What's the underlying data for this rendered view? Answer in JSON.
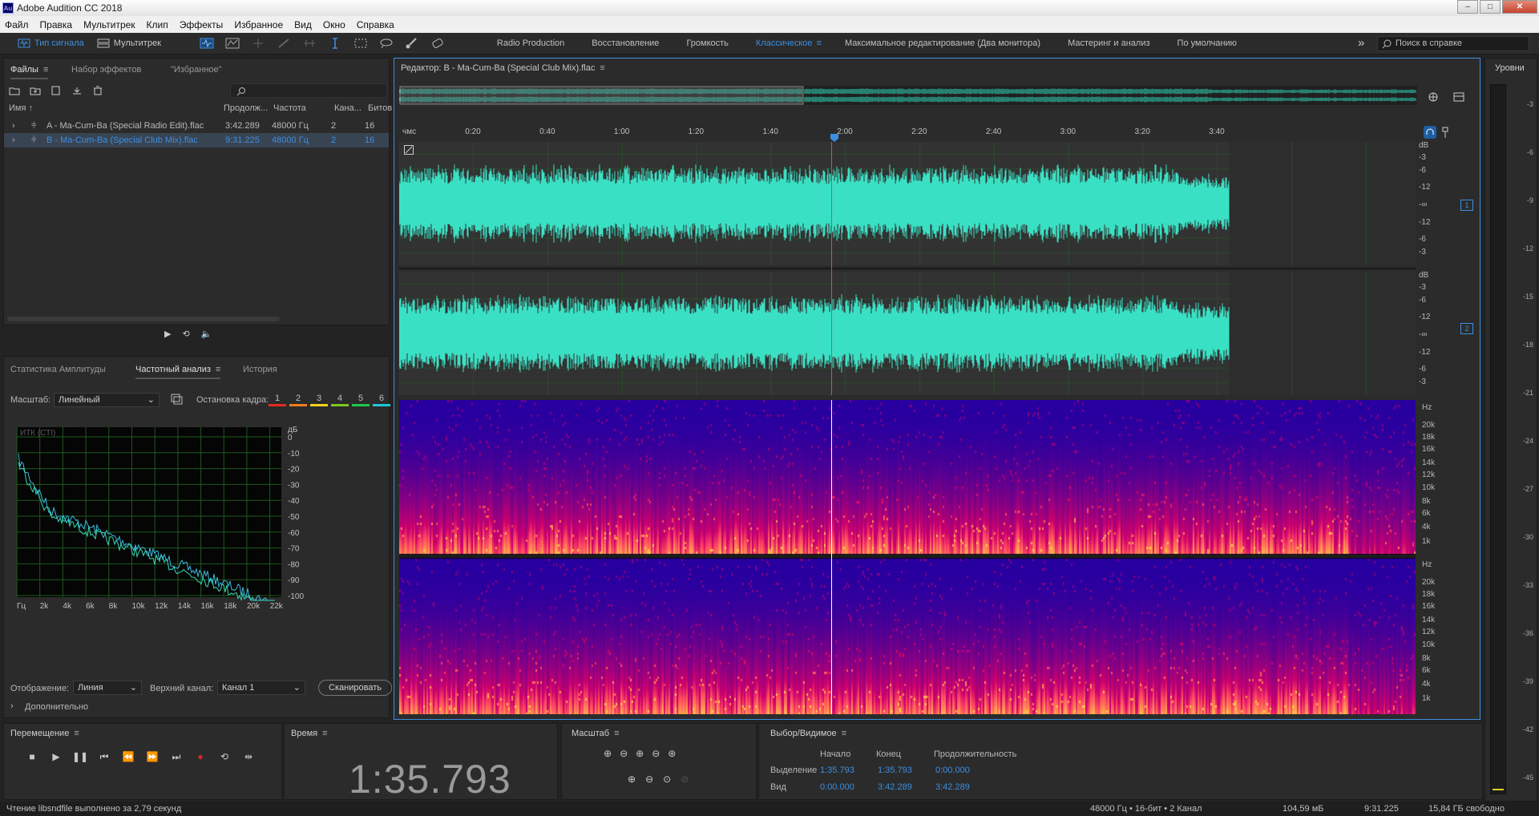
{
  "window": {
    "title": "Adobe Audition CC 2018",
    "icon_label": "Au",
    "minimize": "‒",
    "maximize": "□",
    "close": "✕"
  },
  "menu": [
    "Файл",
    "Правка",
    "Мультитрек",
    "Клип",
    "Эффекты",
    "Избранное",
    "Вид",
    "Окно",
    "Справка"
  ],
  "toolbar": {
    "waveform_label": "Тип сигнала",
    "multitrack_label": "Мультитрек",
    "workspaces": [
      "Radio Production",
      "Восстановление",
      "Громкость",
      "Классическое",
      "Максимальное редактирование (Два монитора)",
      "Мастеринг и анализ",
      "По умолчанию"
    ],
    "active_workspace": "Классическое",
    "more": "»",
    "search_placeholder": "Поиск в справке"
  },
  "files_panel": {
    "tab_files": "Файлы",
    "tab_effects": "Набор эффектов",
    "tab_fav": "\"Избранное\"",
    "columns": [
      "Имя ↑",
      "Продолж...",
      "Частота",
      "Кана...",
      "Битов"
    ],
    "rows": [
      {
        "name": "A - Ma-Cum-Ba (Special Radio Edit).flac",
        "dur": "3:42.289",
        "rate": "48000 Гц",
        "ch": "2",
        "bits": "16"
      },
      {
        "name": "B - Ma-Cum-Ba (Special Club Mix).flac",
        "dur": "9:31.225",
        "rate": "48000 Гц",
        "ch": "2",
        "bits": "16"
      }
    ]
  },
  "analysis_panel": {
    "tab_amp": "Статистика Амплитуды",
    "tab_freq": "Частотный анализ",
    "tab_hist": "История",
    "scale_label": "Масштаб:",
    "scale_value": "Линейный",
    "freeze_label": "Остановка кадра:",
    "freeze_slots": [
      "1",
      "2",
      "3",
      "4",
      "5",
      "6"
    ],
    "freeze_colors": [
      "#e8281e",
      "#f07c1e",
      "#f2d21e",
      "#7ac81e",
      "#1ec84a",
      "#1ec8d8"
    ],
    "graph_title": "ИТК (СТІ)",
    "db_unit": "дБ",
    "db_ticks": [
      "0",
      "-10",
      "-20",
      "-30",
      "-40",
      "-50",
      "-60",
      "-70",
      "-80",
      "-90",
      "-100"
    ],
    "hz_ticks": [
      "Гц",
      "2k",
      "4k",
      "6k",
      "8k",
      "10k",
      "12k",
      "14k",
      "16k",
      "18k",
      "20k",
      "22k"
    ],
    "display_label": "Отображение:",
    "display_value": "Линия",
    "channel_label": "Верхний канал:",
    "channel_value": "Канал 1",
    "scan_button": "Сканировать",
    "advanced": "Дополнительно"
  },
  "editor": {
    "title": "Редактор: B - Ma-Cum-Ba (Special Club Mix).flac",
    "ruler_unit": "чмс",
    "ruler_ticks": [
      "0:20",
      "0:40",
      "1:00",
      "1:20",
      "1:40",
      "2:00",
      "2:20",
      "2:40",
      "3:00",
      "3:20",
      "3:40"
    ],
    "db_scale": [
      "dB",
      "-3",
      "-6",
      "-12",
      "-∞",
      "-12",
      "-6",
      "-3"
    ],
    "hz_scale": [
      "Hz",
      "20k",
      "18k",
      "16k",
      "14k",
      "12k",
      "10k",
      "8k",
      "6k",
      "4k",
      "1k"
    ],
    "channel1": "1",
    "channel2": "2"
  },
  "levels": {
    "title": "Уровни",
    "ticks": [
      "-3",
      "-6",
      "-9",
      "-12",
      "-15",
      "-18",
      "-21",
      "-24",
      "-27",
      "-30",
      "-33",
      "-36",
      "-39",
      "-42",
      "-45"
    ]
  },
  "transport": {
    "title": "Перемещение"
  },
  "time": {
    "title": "Время",
    "value": "1:35.793"
  },
  "zoom": {
    "title": "Масштаб"
  },
  "selection": {
    "title": "Выбор/Видимое",
    "col_start": "Начало",
    "col_end": "Конец",
    "col_dur": "Продолжительность",
    "row_sel": "Выделение",
    "sel_start": "1:35.793",
    "sel_end": "1:35.793",
    "sel_dur": "0:00.000",
    "row_view": "Вид",
    "view_start": "0:00.000",
    "view_end": "3:42.289",
    "view_dur": "3:42.289"
  },
  "status": {
    "message": "Чтение libsndfile выполнено за 2,79 секунд",
    "format": "48000 Гц • 16-бит • 2 Канал",
    "size": "104,59 мБ",
    "duration": "9:31.225",
    "free": "15,84 ГБ свободно"
  }
}
